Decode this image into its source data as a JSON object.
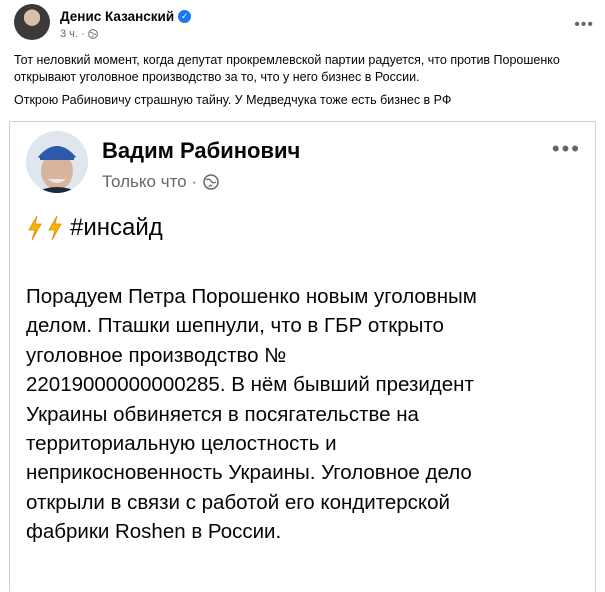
{
  "outer_post": {
    "author": "Денис Казанский",
    "time": "3 ч. ·",
    "paragraph_1": "Тот неловкий момент, когда депутат прокремлевской партии радуется, что против Порошенко открывают уголовное производство за то, что у него бизнес в России.",
    "paragraph_2": "Открою Рабиновичу страшную тайну. У Медведчука тоже есть бизнес в РФ"
  },
  "shared_post": {
    "author": "Вадим Рабинович",
    "time": "Только что ·",
    "hashtag": "#инсайд",
    "body": "Порадуем Петра Порошенко новым уголовным\nделом. Пташки шепнули, что в ГБР открыто\nуголовное производство №\n22019000000000285. В нём бывший президент\nУкраины обвиняется в посягательстве на\nтерриториальную целостность и\nнеприкосновенность Украины. Уголовное дело\nоткрыли в связи с работой его кондитерской\nфабрики Roshen в России."
  },
  "icons": {
    "verified": "verified-badge-icon",
    "globe": "globe-icon",
    "more": "more-options-icon",
    "bolt": "high-voltage-emoji"
  },
  "colors": {
    "verified": "#1877f2",
    "secondary_text": "#65676b",
    "bolt": "#f7b500"
  }
}
